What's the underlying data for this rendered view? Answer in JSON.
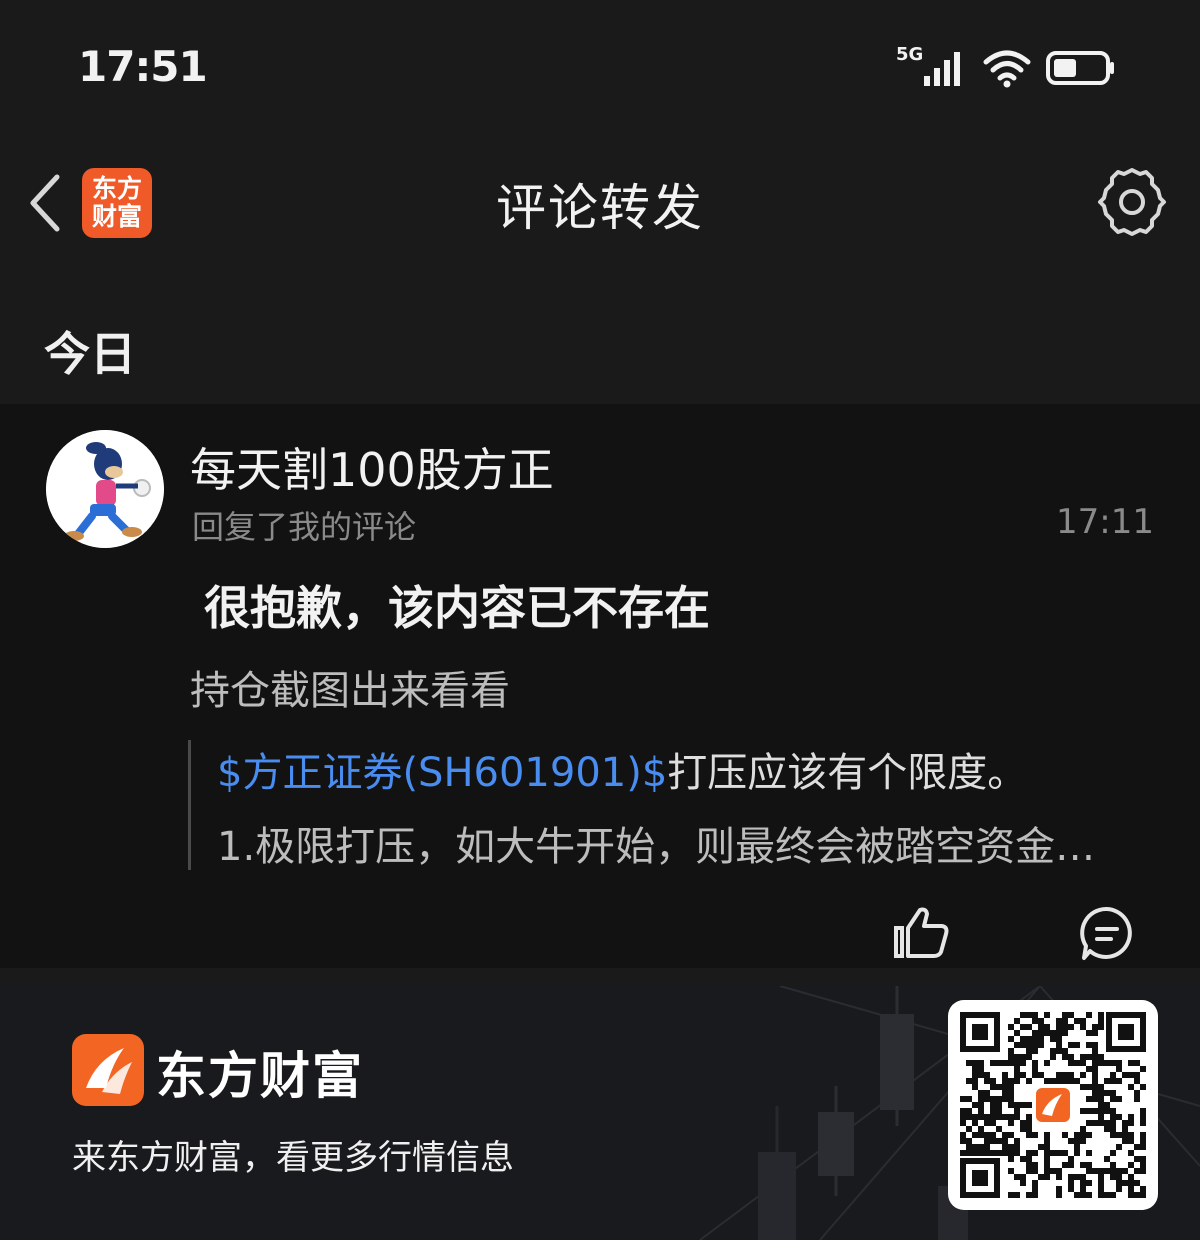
{
  "status_bar": {
    "time": "17:51",
    "network": "5G",
    "icons": [
      "signal-icon",
      "wifi-icon",
      "battery-icon"
    ]
  },
  "header": {
    "title": "评论转发",
    "app_badge": {
      "line1": "东方",
      "line2": "财富"
    },
    "back_icon": "chevron-left-icon",
    "settings_icon": "gear-icon"
  },
  "section": {
    "label": "今日"
  },
  "notification": {
    "user_name": "每天割100股方正",
    "action": "回复了我的评论",
    "time": "17:11",
    "deleted_notice": "很抱歉，该内容已不存在",
    "reply": "持仓截图出来看看",
    "quote": {
      "stock_link": "$方正证券(SH601901)$",
      "line1_rest": "打压应该有个限度。",
      "line2": "1.极限打压，如大牛开始，则最终会被踏空资金…"
    },
    "actions": [
      "thumbs-up-icon",
      "comment-icon"
    ]
  },
  "footer": {
    "brand": "东方财富",
    "slogan": "来东方财富，看更多行情信息"
  },
  "colors": {
    "background": "#1a1a1a",
    "card": "#121212",
    "accent_orange": "#f05a28",
    "link_blue": "#4a8df0",
    "muted_text": "#8a8a8a"
  }
}
